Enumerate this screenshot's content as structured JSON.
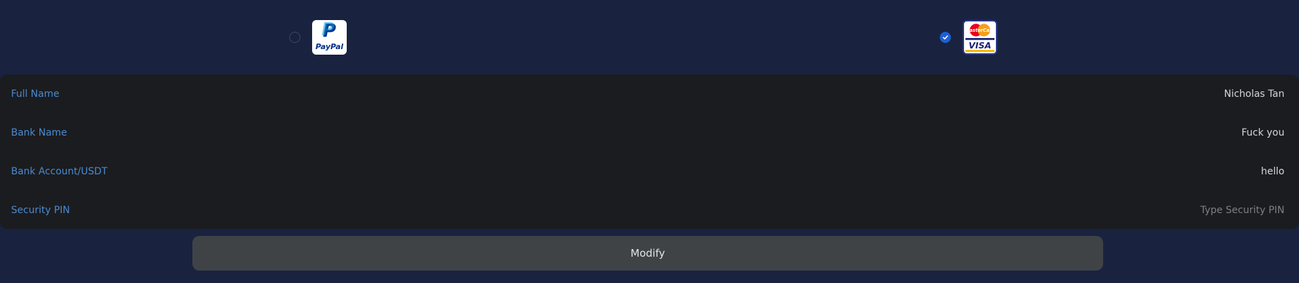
{
  "payment_methods": {
    "paypal": {
      "selected": false,
      "logo_text": "PayPal",
      "logo_mark": "P",
      "colors": {
        "dark": "#003087",
        "light": "#009cde"
      }
    },
    "card": {
      "selected": true,
      "mastercard_text": "MasterCard",
      "visa_text": "VISA",
      "colors": {
        "mc_red": "#eb001b",
        "mc_orange": "#f79e1b",
        "visa_blue": "#1a1f71",
        "accent": "#1f5fd4"
      }
    }
  },
  "form": {
    "full_name": {
      "label": "Full Name",
      "value": "Nicholas Tan"
    },
    "bank_name": {
      "label": "Bank Name",
      "value": "Fuck you"
    },
    "bank_account": {
      "label": "Bank Account/USDT",
      "value": "hello"
    },
    "security_pin": {
      "label": "Security PIN",
      "value": "",
      "placeholder": "Type Security PIN"
    }
  },
  "actions": {
    "modify_label": "Modify"
  },
  "theme": {
    "background": "#19233f",
    "panel": "#1b1c1f",
    "label_color": "#4a8ad0",
    "button": "#404346"
  }
}
